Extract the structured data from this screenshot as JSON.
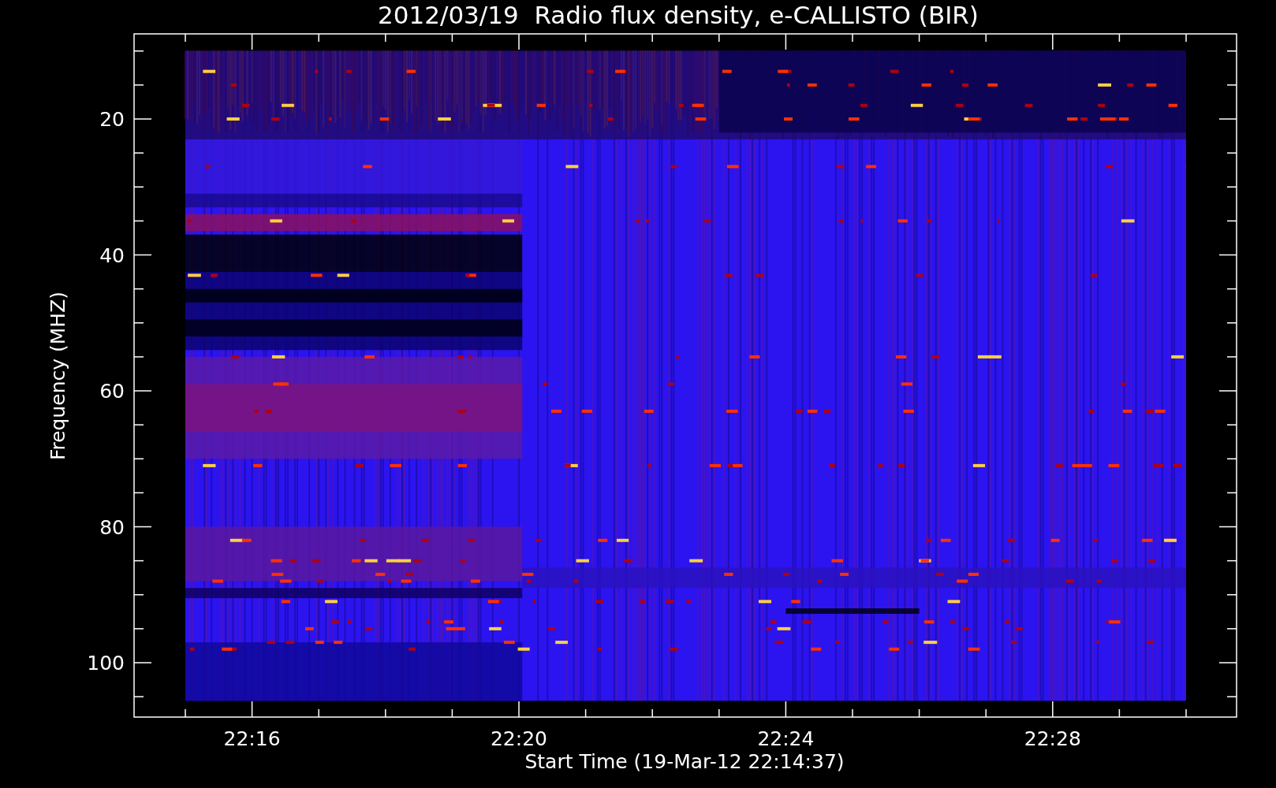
{
  "title": "2012/03/19  Radio flux density, e-CALLISTO (BIR)",
  "y_axis": {
    "label": "Frequency (MHZ)",
    "ticks": [
      "20",
      "40",
      "60",
      "80",
      "100"
    ]
  },
  "x_axis": {
    "label": "Start Time (19-Mar-12 22:14:37)",
    "ticks": [
      "22:16",
      "22:20",
      "22:24",
      "22:28"
    ]
  }
}
